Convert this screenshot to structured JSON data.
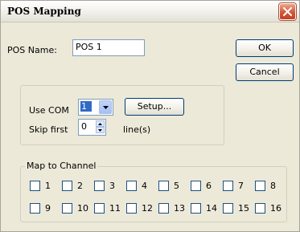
{
  "window": {
    "title": "POS Mapping"
  },
  "pos_name": {
    "label": "POS Name:",
    "value": "POS 1"
  },
  "buttons": {
    "ok": "OK",
    "cancel": "Cancel",
    "setup": "Setup..."
  },
  "com_settings": {
    "use_com_label": "Use COM",
    "com_value": "1",
    "skip_first_label": "Skip first",
    "skip_value": "0",
    "lines_label": "line(s)"
  },
  "channel_group": {
    "legend": "Map to Channel",
    "channels": [
      {
        "label": "1",
        "checked": false
      },
      {
        "label": "2",
        "checked": false
      },
      {
        "label": "3",
        "checked": false
      },
      {
        "label": "4",
        "checked": false
      },
      {
        "label": "5",
        "checked": false
      },
      {
        "label": "6",
        "checked": false
      },
      {
        "label": "7",
        "checked": false
      },
      {
        "label": "8",
        "checked": false
      },
      {
        "label": "9",
        "checked": false
      },
      {
        "label": "10",
        "checked": false
      },
      {
        "label": "11",
        "checked": false
      },
      {
        "label": "12",
        "checked": false
      },
      {
        "label": "13",
        "checked": false
      },
      {
        "label": "14",
        "checked": false
      },
      {
        "label": "15",
        "checked": false
      },
      {
        "label": "16",
        "checked": false
      }
    ]
  },
  "colors": {
    "dialog_bg": "#ece9d8",
    "close_button": "#d4573a",
    "selection": "#316ac5"
  },
  "icons": {
    "close": "close-icon",
    "dropdown": "chevron-down-icon",
    "spin_up": "arrow-up-icon",
    "spin_down": "arrow-down-icon"
  }
}
